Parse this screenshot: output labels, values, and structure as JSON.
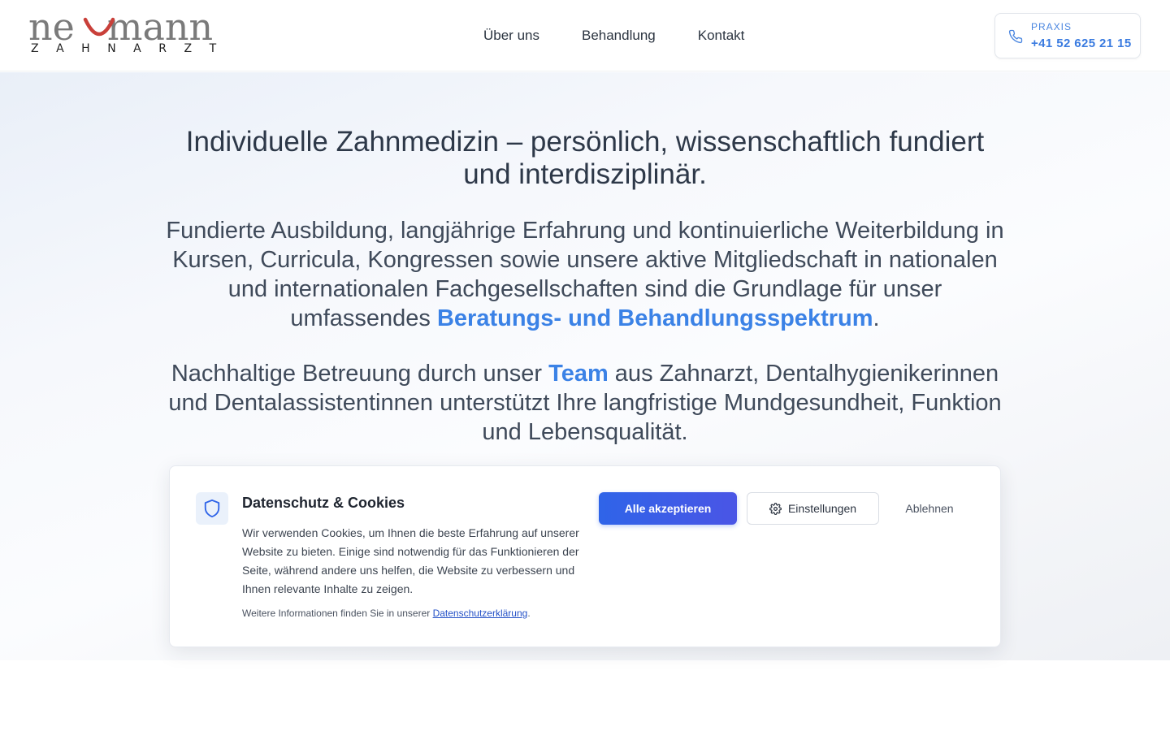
{
  "brand": {
    "logo_word": "neumann",
    "logo_sub": "ZAHNARZT",
    "accent": "#c9403a"
  },
  "nav": {
    "items": [
      {
        "label": "Über uns"
      },
      {
        "label": "Behandlung"
      },
      {
        "label": "Kontakt"
      }
    ]
  },
  "contact": {
    "label": "PRAXIS",
    "phone": "+41 52 625 21 15",
    "icon": "phone-icon"
  },
  "hero": {
    "title": "Individuelle Zahnmedizin – persönlich, wissenschaftlich fundiert und interdisziplinär.",
    "p1_before": "Fundierte Ausbildung, langjährige Erfahrung und kontinuierliche Weiterbildung in Kursen, Curricula, Kongressen sowie unsere aktive Mitgliedschaft in nationalen und internationalen Fachgesellschaften sind die Grundlage für unser umfassendes ",
    "p1_link": "Beratungs- und Behandlungsspektrum",
    "p1_after": ".",
    "p2_before": "Nachhaltige Betreuung durch unser ",
    "p2_link": "Team",
    "p2_after": " aus Zahnarzt, Dentalhygienikerinnen und Dentalassistentinnen unterstützt Ihre langfristige Mundgesundheit, Funktion und Lebensqualität."
  },
  "cookie": {
    "icon": "shield-icon",
    "title": "Datenschutz & Cookies",
    "text": "Wir verwenden Cookies, um Ihnen die beste Erfahrung auf unserer Website zu bieten. Einige sind notwendig für das Funktionieren der Seite, während andere uns helfen, die Website zu verbessern und Ihnen relevante Inhalte zu zeigen.",
    "more_prefix": "Weitere Informationen finden Sie in unserer ",
    "more_link": "Datenschutzerklärung",
    "more_suffix": ".",
    "accept_label": "Alle akzeptieren",
    "settings_label": "Einstellungen",
    "settings_icon": "gear-icon",
    "reject_label": "Ablehnen"
  },
  "colors": {
    "link": "#3b82e6",
    "primary_button": "#2f64e8",
    "text": "#2d3848"
  }
}
